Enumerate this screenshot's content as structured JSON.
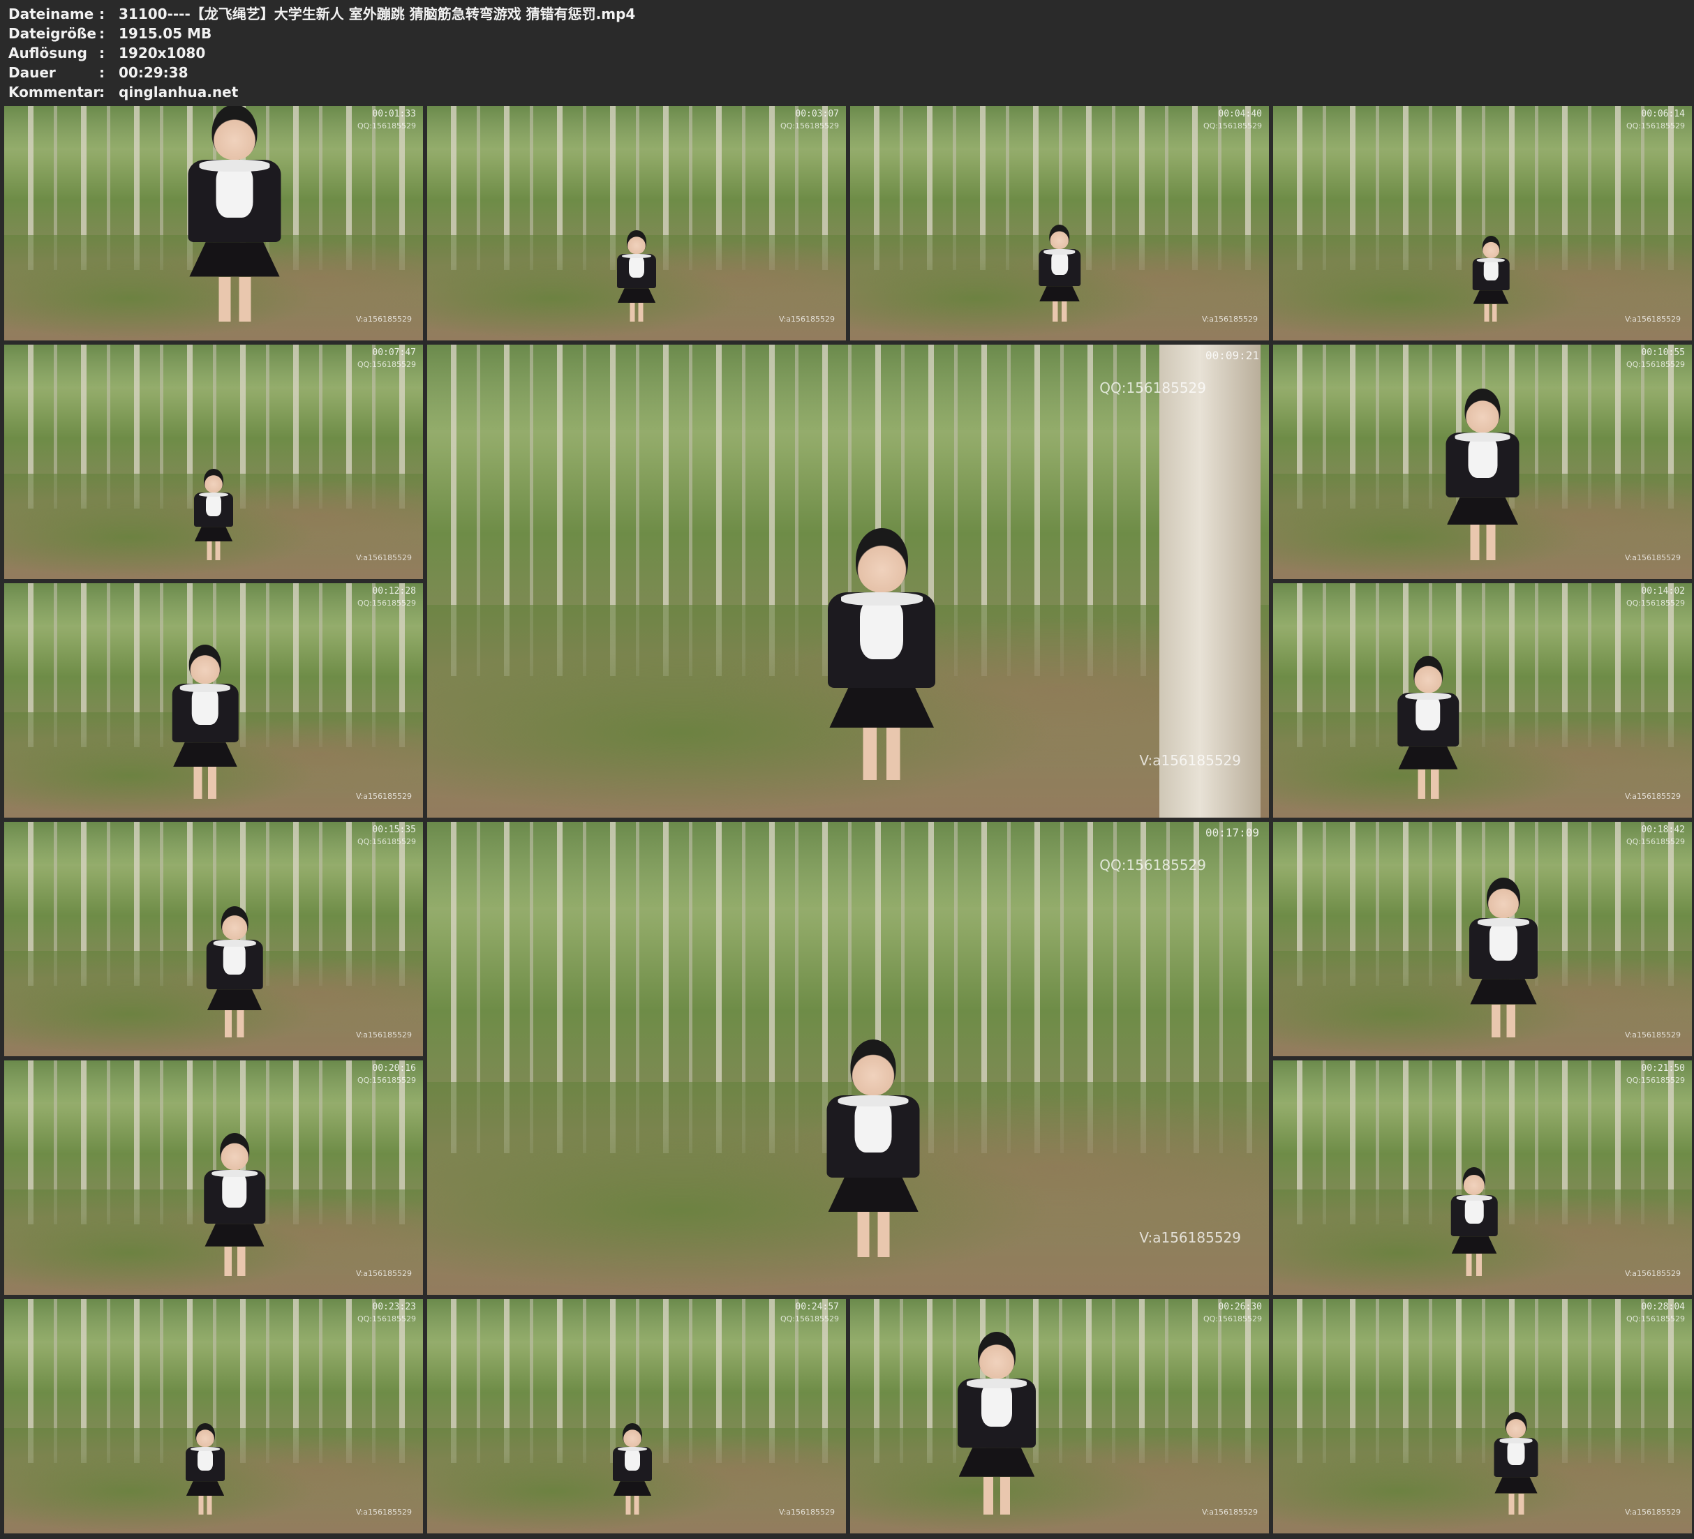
{
  "header": [
    {
      "key": "Dateiname",
      "sep": ":",
      "value": "31100----【龙飞绳艺】大学生新人 室外蹦跳 猜脑筋急转弯游戏 猜错有惩罚.mp4"
    },
    {
      "key": "Dateigröße",
      "sep": ":",
      "value": "1915.05 MB"
    },
    {
      "key": "Auflösung",
      "sep": ":",
      "value": "1920x1080"
    },
    {
      "key": "Dauer",
      "sep": ":",
      "value": "00:29:38"
    },
    {
      "key": "Kommentar",
      "sep": ":",
      "value": "qinglanhua.net"
    }
  ],
  "watermark_qq": "QQ:156185529",
  "watermark_v": "V:a156185529",
  "thumbnails": [
    {
      "time": "00:01:33"
    },
    {
      "time": "00:03:07"
    },
    {
      "time": "00:04:40"
    },
    {
      "time": "00:06:14"
    },
    {
      "time": "00:07:47"
    },
    {
      "time": "00:09:21"
    },
    {
      "time": "00:10:55"
    },
    {
      "time": "00:12:28"
    },
    {
      "time": "00:14:02"
    },
    {
      "time": "00:15:35"
    },
    {
      "time": "00:17:09"
    },
    {
      "time": "00:18:42"
    },
    {
      "time": "00:20:16"
    },
    {
      "time": "00:21:50"
    },
    {
      "time": "00:23:23"
    },
    {
      "time": "00:24:57"
    },
    {
      "time": "00:26:30"
    },
    {
      "time": "00:28:04"
    }
  ]
}
